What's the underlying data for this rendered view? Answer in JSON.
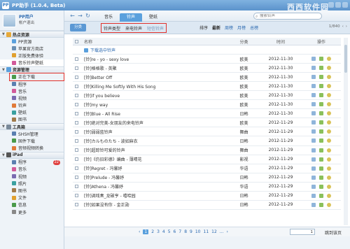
{
  "app": {
    "title": "PP助手 (1.0.4, Beta)",
    "logo_text": "PP",
    "watermark": "西西软件园"
  },
  "user": {
    "name": "PP用户",
    "status": "帐户退出"
  },
  "sidebar": {
    "sections": [
      {
        "label": "热点资源",
        "items": [
          "PP资源",
          "苹果官方商店",
          "正版免费体验",
          "音乐铃声壁纸"
        ]
      },
      {
        "label": "资源管理",
        "items": [
          "正在下载",
          "程序",
          "音乐",
          "视频",
          "铃声",
          "壁纸",
          "图书"
        ]
      },
      {
        "label": "工具箱",
        "items": [
          "SHSH管理",
          "固件下载",
          "音频视频转换"
        ]
      },
      {
        "label": "iPad",
        "items": [
          "程序",
          "音乐",
          "视频",
          "照片",
          "图书",
          "文件",
          "信息",
          "更多"
        ]
      }
    ],
    "ipad_badge": "22"
  },
  "toolbar": {
    "tabs": [
      "音乐",
      "铃声",
      "壁纸"
    ],
    "active_tab": "铃声",
    "search_placeholder": "搜索铃声"
  },
  "filter": {
    "category_button": "分类",
    "tabs": [
      "铃声类型",
      "来电铃声",
      "短信铃声"
    ],
    "sort_items": [
      "排序",
      "最新",
      "周榜",
      "月榜",
      "总榜"
    ],
    "page_info": "1/840"
  },
  "table": {
    "headers": {
      "name": "名称",
      "category": "分类",
      "time": "时间",
      "ops": "操作"
    },
    "download_all": "下载选中铃声",
    "rows": [
      {
        "name": "[铃]re - yo - sexy love",
        "category": "欧美",
        "time": "2012-11-30"
      },
      {
        "name": "[铃]格格歌 - 英聚",
        "category": "欧美",
        "time": "2012-11-30"
      },
      {
        "name": "[铃]Better Off",
        "category": "欧美",
        "time": "2012-11-30"
      },
      {
        "name": "[铃]Killing Me Softly With His Song",
        "category": "欧美",
        "time": "2012-11-30"
      },
      {
        "name": "[铃]if you believe",
        "category": "欧美",
        "time": "2012-11-30"
      },
      {
        "name": "[铃]my way",
        "category": "欧美",
        "time": "2012-11-30"
      },
      {
        "name": "[铃]Blue - All Rise",
        "category": "日韩",
        "time": "2012-11-30"
      },
      {
        "name": "[铃]绝对完美-女朋友的来电铃声",
        "category": "欧美",
        "time": "2012-11-29"
      },
      {
        "name": "[铃]弱弱蓝铃声",
        "category": "舞曲",
        "time": "2012-11-29"
      },
      {
        "name": "[铃]カルものたち - 波如麻衣",
        "category": "日韩",
        "time": "2012-11-29"
      },
      {
        "name": "[铃]超踪铃可爱的铃声",
        "category": "舞曲",
        "time": "2012-11-29"
      },
      {
        "name": "[铃]《仍旧彩德》编曲 - 薄晴花",
        "category": "影视",
        "time": "2012-11-29"
      },
      {
        "name": "[铃]Regret - 冯馨妤",
        "category": "华语",
        "time": "2012-11-29"
      },
      {
        "name": "[铃]Prelude - 冯馨妤",
        "category": "日韩",
        "time": "2012-11-29"
      },
      {
        "name": "[铃]Athena - 冯馨妤",
        "category": "华语",
        "time": "2012-11-29"
      },
      {
        "name": "[铃]调戏奏_龙破亨 - 嘻哈园",
        "category": "日韩",
        "time": "2012-11-29"
      },
      {
        "name": "[铃]如果没有你 - 金正勋",
        "category": "日韩",
        "time": "2012-11-29"
      }
    ]
  },
  "pager": {
    "pages": [
      "1",
      "2",
      "3",
      "4",
      "5",
      "6",
      "7",
      "8",
      "9",
      "10",
      "11",
      "12",
      "..."
    ],
    "current": "1",
    "prev": "‹",
    "next": "›",
    "input_value": "1",
    "go_label": "跳到该页"
  },
  "colors": {
    "accent": "#5aa0dd",
    "highlight_border": "#e0302a",
    "link": "#2b69b0"
  }
}
